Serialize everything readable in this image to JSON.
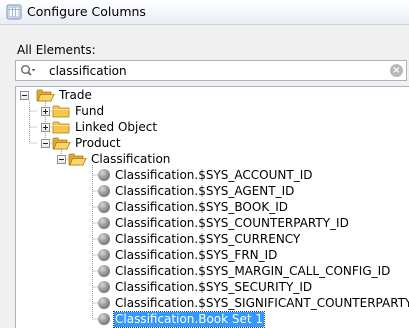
{
  "window": {
    "title": "Configure Columns"
  },
  "elements_label": "All Elements:",
  "search": {
    "value": "classification",
    "placeholder": ""
  },
  "tree": {
    "root": "Trade",
    "trade_children": [
      "Fund",
      "Linked Object",
      "Product"
    ],
    "product_child": "Classification",
    "leaves": [
      "Classification.$SYS_ACCOUNT_ID",
      "Classification.$SYS_AGENT_ID",
      "Classification.$SYS_BOOK_ID",
      "Classification.$SYS_COUNTERPARTY_ID",
      "Classification.$SYS_CURRENCY",
      "Classification.$SYS_FRN_ID",
      "Classification.$SYS_MARGIN_CALL_CONFIG_ID",
      "Classification.$SYS_SECURITY_ID",
      "Classification.$SYS_SIGNIFICANT_COUNTERPARTY_ID",
      "Classification.Book Set 1"
    ],
    "selected": "Classification.Book Set 1"
  },
  "colors": {
    "selection": "#3399ff",
    "folder": "#f5c84c"
  }
}
